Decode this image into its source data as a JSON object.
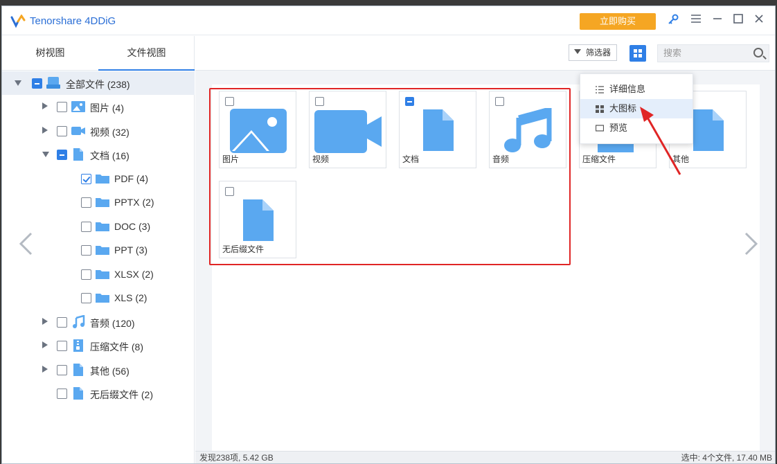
{
  "app": {
    "title": "Tenorshare 4DDiG",
    "buy_label": "立即购买"
  },
  "left_tabs": [
    {
      "label": "树视图"
    },
    {
      "label": "文件视图"
    }
  ],
  "tree": [
    {
      "label": "全部文件 (238)"
    },
    {
      "label": "图片 (4)"
    },
    {
      "label": "视频 (32)"
    },
    {
      "label": "文档 (16)"
    },
    {
      "label": "PDF (4)"
    },
    {
      "label": "PPTX (2)"
    },
    {
      "label": "DOC (3)"
    },
    {
      "label": "PPT (3)"
    },
    {
      "label": "XLSX (2)"
    },
    {
      "label": "XLS (2)"
    },
    {
      "label": "音频 (120)"
    },
    {
      "label": "压缩文件 (8)"
    },
    {
      "label": "其他 (56)"
    },
    {
      "label": "无后缀文件 (2)"
    }
  ],
  "toolbar": {
    "filter_label": "筛选器",
    "search_placeholder": "搜索"
  },
  "view_menu": [
    {
      "label": "详细信息"
    },
    {
      "label": "大图标"
    },
    {
      "label": "预览"
    }
  ],
  "cards": [
    {
      "name": "图片"
    },
    {
      "name": "视频"
    },
    {
      "name": "文档"
    },
    {
      "name": "音频"
    },
    {
      "name": "压缩文件"
    },
    {
      "name": "其他"
    },
    {
      "name": "无后缀文件"
    }
  ],
  "status": {
    "found": "发现238项, 5.42 GB",
    "selected": "选中: 4个文件, 17.40 MB"
  },
  "colors": {
    "accent": "#2f7fe6",
    "buy": "#f5a623",
    "highlight_box": "#e02525",
    "file_icon": "#5aa8f0"
  }
}
